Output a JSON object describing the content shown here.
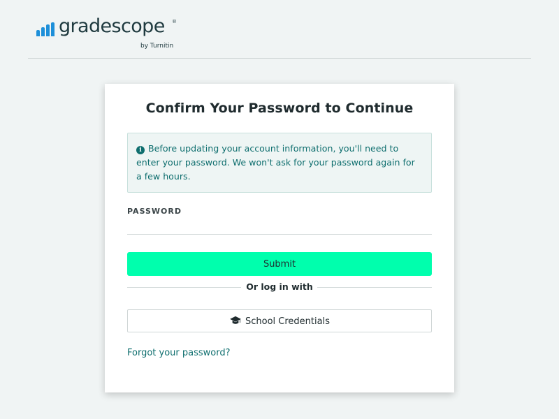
{
  "header": {
    "logo_text": "gradescope",
    "logo_registered": "®",
    "logo_sub": "by Turnitin",
    "brand_color": "#1d8fd9"
  },
  "card": {
    "title": "Confirm Your Password to Continue",
    "info_icon": "info-icon",
    "info_text": "Before updating your account information, you'll need to enter your password. We won't ask for your password again for a few hours.",
    "password_label": "PASSWORD",
    "password_value": "",
    "submit_label": "Submit",
    "submit_color": "#00ffad",
    "divider_text": "Or log in with",
    "school_button_icon": "graduation-cap-icon",
    "school_button_label": "School Credentials",
    "forgot_link": "Forgot your password?",
    "link_color": "#0e6e6e"
  }
}
